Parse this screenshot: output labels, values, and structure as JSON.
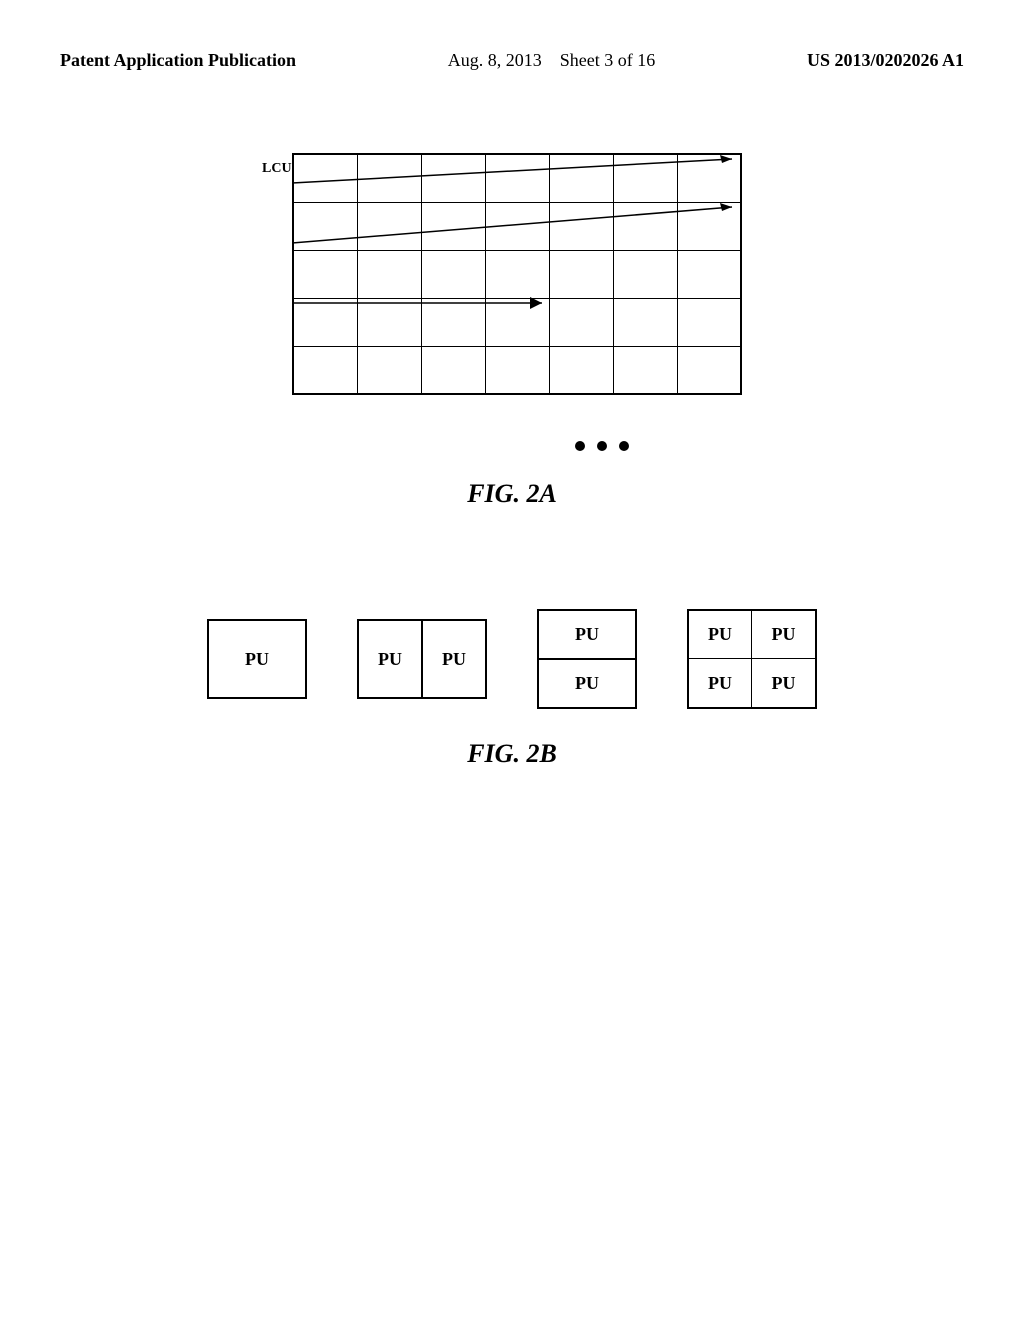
{
  "header": {
    "left_label": "Patent Application Publication",
    "center_date": "Aug. 8, 2013",
    "center_sheet": "Sheet 3 of 16",
    "right_patent": "US 2013/0202026 A1"
  },
  "fig2a": {
    "caption": "FIG. 2A",
    "lcu_label": "LCU",
    "grid_rows": 5,
    "grid_cols": 7
  },
  "fig2b": {
    "caption": "FIG. 2B",
    "pu_label": "PU"
  }
}
